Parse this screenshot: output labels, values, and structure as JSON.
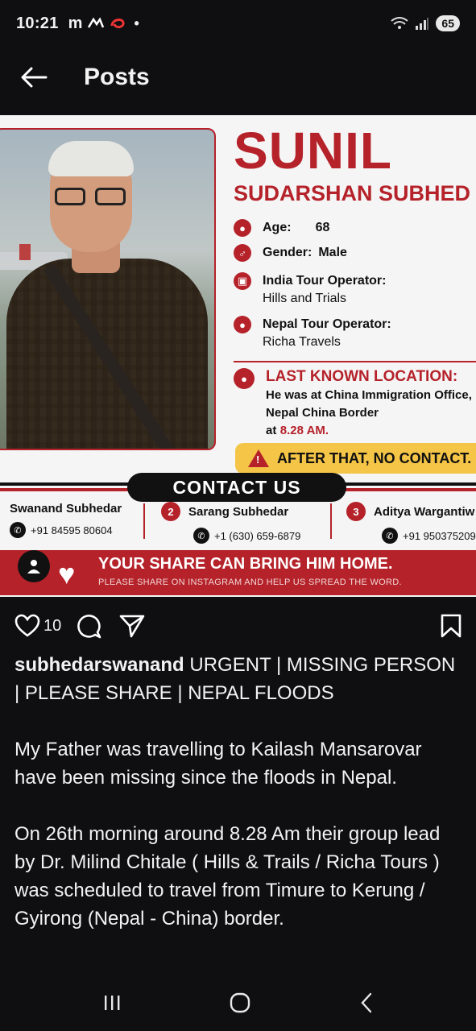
{
  "status_bar": {
    "time": "10:21",
    "left_icons": "m",
    "battery": "65"
  },
  "header": {
    "title": "Posts"
  },
  "poster": {
    "first_name": "SUNIL",
    "last_name": "SUDARSHAN SUBHED",
    "age_label": "Age:",
    "age_value": "68",
    "gender_label": "Gender:",
    "gender_value": "Male",
    "india_operator_label": "India Tour Operator:",
    "india_operator_value": "Hills and Trials",
    "nepal_operator_label": "Nepal Tour Operator:",
    "nepal_operator_value": "Richa Travels",
    "last_location_title": "LAST KNOWN LOCATION:",
    "last_location_line1": "He was at China Immigration Office,",
    "last_location_line2": "Nepal China Border",
    "last_location_at": "at",
    "last_location_time": "8.28 AM.",
    "after_text": "AFTER THAT, NO CONTACT.",
    "contact_title": "CONTACT US",
    "contacts": [
      {
        "name": "Swanand Subhedar",
        "phone": "+91 84595 80604"
      },
      {
        "num": "2",
        "name": "Sarang Subhedar",
        "phone": "+1 (630) 659-6879"
      },
      {
        "num": "3",
        "name": "Aditya Wargantiw",
        "phone": "+91 950375209"
      }
    ],
    "banner_title": "YOUR SHARE CAN BRING HIM HOME.",
    "banner_subtitle": "PLEASE SHARE ON INSTAGRAM AND HELP US SPREAD THE WORD."
  },
  "actions": {
    "like_count": "10"
  },
  "caption": {
    "username": "subhedarswanand",
    "headline": "URGENT | MISSING PERSON | PLEASE SHARE | NEPAL FLOODS",
    "paragraph1": "My Father was travelling to Kailash Mansarovar have been missing since the floods in Nepal.",
    "paragraph2": "On 26th morning around 8.28 Am their group lead by Dr. Milind Chitale ( Hills & Trails / Richa Tours ) was scheduled to travel from Timure to Kerung / Gyirong (Nepal - China) border."
  },
  "colors": {
    "accent_red": "#b5222a",
    "warning_yellow": "#f4c546",
    "background": "#0f0f12"
  },
  "icons": {
    "back": "arrow-left-icon",
    "like": "heart-icon",
    "comment": "comment-icon",
    "share": "send-icon",
    "save": "bookmark-icon"
  }
}
